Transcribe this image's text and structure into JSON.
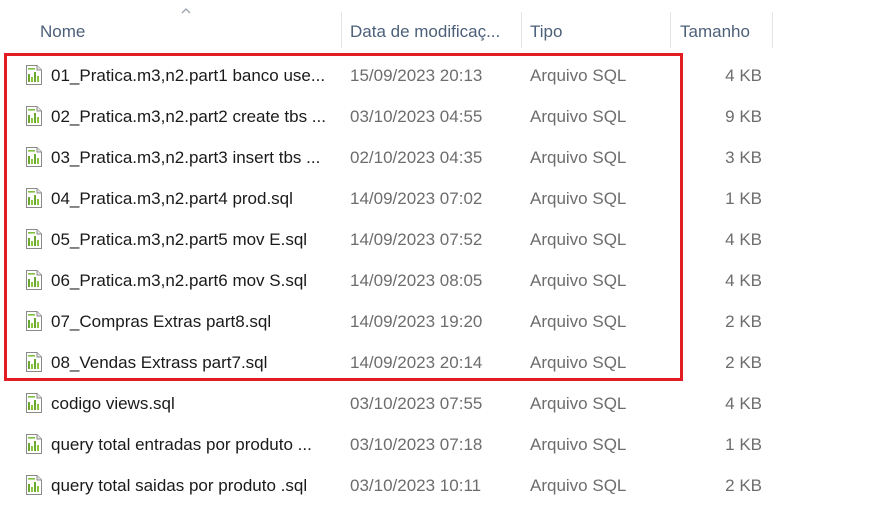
{
  "columns": {
    "name": "Nome",
    "date": "Data de modificaç...",
    "type": "Tipo",
    "size": "Tamanho"
  },
  "sort": {
    "column": "name",
    "icon": "sort-up-chevron-icon"
  },
  "file_icon": "sql-file-icon",
  "highlight": {
    "color": "#e31b23",
    "rows_from": 1,
    "rows_to": 8
  },
  "files": [
    {
      "name": "01_Pratica.m3,n2.part1 banco use...",
      "date": "15/09/2023 20:13",
      "type": "Arquivo SQL",
      "size": "4 KB"
    },
    {
      "name": "02_Pratica.m3,n2.part2 create tbs ...",
      "date": "03/10/2023 04:55",
      "type": "Arquivo SQL",
      "size": "9 KB"
    },
    {
      "name": "03_Pratica.m3,n2.part3 insert tbs ...",
      "date": "02/10/2023 04:35",
      "type": "Arquivo SQL",
      "size": "3 KB"
    },
    {
      "name": "04_Pratica.m3,n2.part4 prod.sql",
      "date": "14/09/2023 07:02",
      "type": "Arquivo SQL",
      "size": "1 KB"
    },
    {
      "name": "05_Pratica.m3,n2.part5 mov E.sql",
      "date": "14/09/2023 07:52",
      "type": "Arquivo SQL",
      "size": "4 KB"
    },
    {
      "name": "06_Pratica.m3,n2.part6 mov S.sql",
      "date": "14/09/2023 08:05",
      "type": "Arquivo SQL",
      "size": "4 KB"
    },
    {
      "name": "07_Compras Extras part8.sql",
      "date": "14/09/2023 19:20",
      "type": "Arquivo SQL",
      "size": "2 KB"
    },
    {
      "name": "08_Vendas Extrass part7.sql",
      "date": "14/09/2023 20:14",
      "type": "Arquivo SQL",
      "size": "2 KB"
    },
    {
      "name": "codigo views.sql",
      "date": "03/10/2023 07:55",
      "type": "Arquivo SQL",
      "size": "4 KB"
    },
    {
      "name": "query total entradas por produto ...",
      "date": "03/10/2023 07:18",
      "type": "Arquivo SQL",
      "size": "1 KB"
    },
    {
      "name": "query total saidas por produto .sql",
      "date": "03/10/2023 10:11",
      "type": "Arquivo SQL",
      "size": "2 KB"
    }
  ]
}
